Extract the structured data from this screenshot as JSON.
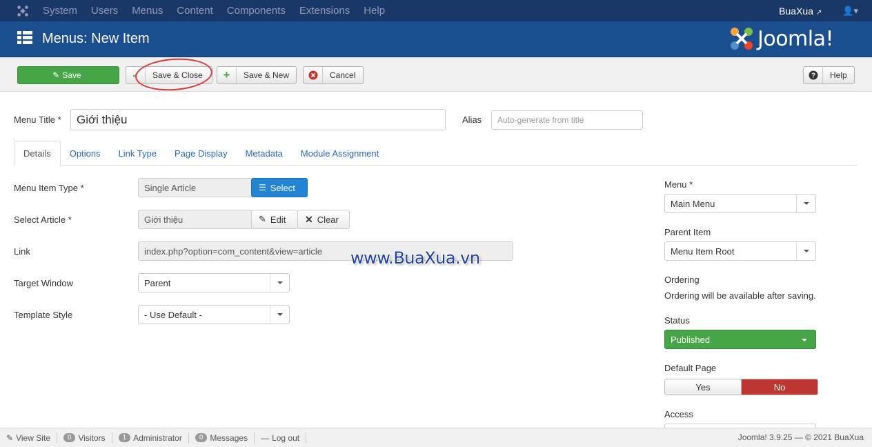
{
  "topnav": {
    "menu": [
      "System",
      "Users",
      "Menus",
      "Content",
      "Components",
      "Extensions",
      "Help"
    ],
    "user": "BuaXua"
  },
  "header": {
    "title": "Menus: New Item",
    "brand": "Joomla!"
  },
  "toolbar": {
    "save": "Save",
    "save_close": "Save & Close",
    "save_new": "Save & New",
    "cancel": "Cancel",
    "help": "Help"
  },
  "form": {
    "menu_title_label": "Menu Title *",
    "menu_title_value": "Giới thiệu",
    "alias_label": "Alias",
    "alias_placeholder": "Auto-generate from title"
  },
  "tabs": [
    "Details",
    "Options",
    "Link Type",
    "Page Display",
    "Metadata",
    "Module Assignment"
  ],
  "details": {
    "menu_item_type_label": "Menu Item Type *",
    "menu_item_type_value": "Single Article",
    "select_btn": "Select",
    "select_article_label": "Select Article *",
    "select_article_value": "Giới thiệu",
    "edit_btn": "Edit",
    "clear_btn": "Clear",
    "link_label": "Link",
    "link_value": "index.php?option=com_content&view=article",
    "target_window_label": "Target Window",
    "target_window_value": "Parent",
    "template_style_label": "Template Style",
    "template_style_value": "- Use Default -"
  },
  "sidebar": {
    "menu_label": "Menu *",
    "menu_value": "Main Menu",
    "parent_label": "Parent Item",
    "parent_value": "Menu Item Root",
    "ordering_label": "Ordering",
    "ordering_note": "Ordering will be available after saving.",
    "status_label": "Status",
    "status_value": "Published",
    "default_page_label": "Default Page",
    "yes": "Yes",
    "no": "No",
    "access_label": "Access"
  },
  "watermark": "www.BuaXua.vn",
  "footer": {
    "view_site": "View Site",
    "visitors_count": "0",
    "visitors": "Visitors",
    "admin_count": "1",
    "administrator": "Administrator",
    "messages_count": "0",
    "messages": "Messages",
    "logout": "Log out",
    "version": "Joomla! 3.9.25 — © 2021 BuaXua"
  },
  "colors": {
    "nav_bg": "#1a3867",
    "header_bg": "#1b4e8f",
    "save_green": "#46a546",
    "select_blue": "#2384d3",
    "no_red": "#bd362f",
    "highlight_circle": "#d33a3a"
  }
}
